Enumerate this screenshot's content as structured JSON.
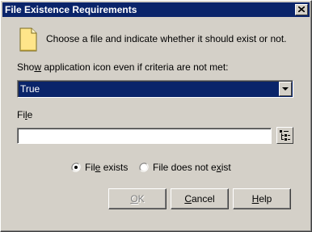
{
  "window": {
    "title": "File Existence Requirements",
    "colors": {
      "titlebar": "#0a246a",
      "face": "#d4d0c8",
      "selection": "#0a246a"
    }
  },
  "intro": {
    "icon": "document-icon",
    "text": "Choose a file and indicate whether it should exist or not."
  },
  "show_icon": {
    "label_pre": "Sho",
    "label_key": "w",
    "label_post": " application icon even if criteria are not met:",
    "selected": "True"
  },
  "file": {
    "label_pre": "Fi",
    "label_key": "l",
    "label_post": "e",
    "value": "",
    "browse_icon": "browse-icon"
  },
  "radios": [
    {
      "pre": "Fil",
      "key": "e",
      "post": " exists",
      "checked": true
    },
    {
      "pre": "File does not e",
      "key": "x",
      "post": "ist",
      "checked": false
    }
  ],
  "buttons": {
    "ok": {
      "key": "O",
      "post": "K",
      "enabled": false
    },
    "cancel": {
      "key": "C",
      "post": "ancel",
      "enabled": true
    },
    "help": {
      "key": "H",
      "post": "elp",
      "enabled": true
    }
  }
}
